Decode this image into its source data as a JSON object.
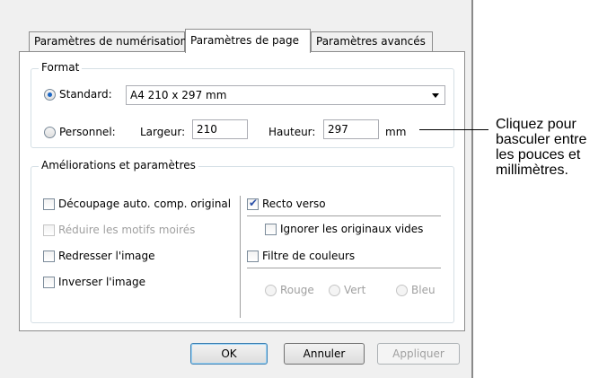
{
  "tabs": [
    "Paramètres de numérisation",
    "Paramètres de page",
    "Paramètres avancés"
  ],
  "format": {
    "legend": "Format",
    "standard_label": "Standard:",
    "standard_value": "A4 210 x 297 mm",
    "custom_label": "Personnel:",
    "width_label": "Largeur:",
    "width_value": "210",
    "height_label": "Hauteur:",
    "height_value": "297",
    "unit": "mm"
  },
  "enhancements": {
    "legend": "Améliorations et paramètres",
    "crop": "Découpage auto. comp. original",
    "moire": "Réduire les motifs moirés",
    "straighten": "Redresser l'image",
    "invert": "Inverser l'image",
    "duplex": "Recto verso",
    "ignore_blank": "Ignorer les originaux vides",
    "color_filter": "Filtre de couleurs",
    "red": "Rouge",
    "green": "Vert",
    "blue": "Bleu"
  },
  "buttons": {
    "ok": "OK",
    "cancel": "Annuler",
    "apply": "Appliquer"
  },
  "callout": [
    "Cliquez pour",
    "basculer entre",
    "les pouces et",
    "millimètres."
  ]
}
